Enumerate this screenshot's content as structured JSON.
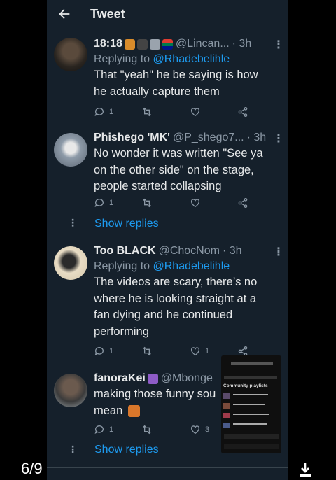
{
  "header": {
    "title": "Tweet"
  },
  "tweets": [
    {
      "name": "18:18",
      "handle": "@Lincan...",
      "time": "· 3h",
      "replying_prefix": "Replying to",
      "replying_to": "@Rhadebelihle",
      "text": "That \"yeah\" he be saying is how he actually capture them",
      "reply_count": "1",
      "retweet_count": "",
      "like_count": ""
    },
    {
      "name": "Phishego 'MK'",
      "handle": "@P_shego7...",
      "time": "· 3h",
      "text": "No wonder it was written \"See ya on the other side\" on the stage, people started collapsing",
      "reply_count": "1",
      "retweet_count": "",
      "like_count": "",
      "show_replies": "Show replies"
    },
    {
      "name": "Too BLACK",
      "handle": "@ChocNom",
      "time": "· 3h",
      "replying_prefix": "Replying to",
      "replying_to": "@Rhadebelihle",
      "text": "The videos are scary, there’s no where he is looking straight at a fan dying and he continued performing",
      "reply_count": "1",
      "retweet_count": "",
      "like_count": "1"
    },
    {
      "name": "fanoraKei",
      "handle": "@Mbonge",
      "text": "making those funny sou mean",
      "reply_count": "1",
      "retweet_count": "",
      "like_count": "3",
      "show_replies": "Show replies"
    }
  ],
  "pip": {
    "heading": "Community playlists"
  },
  "viewer": {
    "counter": "6/9"
  },
  "icons": {
    "back": "arrow-left-icon",
    "reply": "reply-icon",
    "retweet": "retweet-icon",
    "like": "heart-icon",
    "share": "share-icon",
    "more": "more-dots-icon",
    "download": "download-icon"
  },
  "colors": {
    "background": "#15202b",
    "accent": "#1d9bf0",
    "secondary_text": "#8b98a5",
    "primary_text": "#e7e9ea"
  }
}
